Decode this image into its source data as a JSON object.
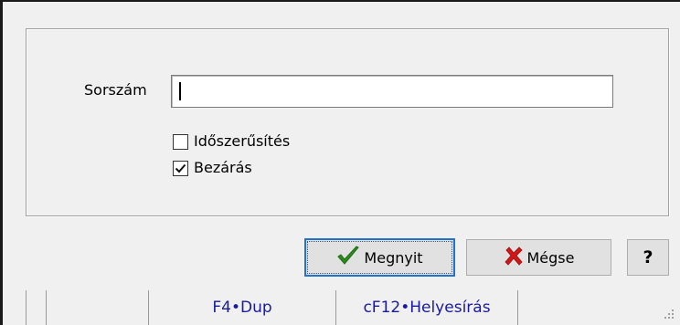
{
  "form": {
    "sorszam_label": "Sorszám",
    "sorszam_value": "",
    "idoszerusites_label": "Időszerűsítés",
    "idoszerusites_checked": false,
    "bezaras_label": "Bezárás",
    "bezaras_checked": true
  },
  "buttons": {
    "open_label": "Megnyit",
    "cancel_label": "Mégse",
    "help_label": "?"
  },
  "statusbar": {
    "cells": [
      "",
      "",
      "F4•Dup",
      "cF12•Helyesírás"
    ]
  },
  "colors": {
    "window_bg": "#f0f0f0",
    "status_text": "#1a1a9c",
    "check_icon": "#2e8b1f",
    "cancel_icon": "#d01818",
    "default_border": "#1c73d2"
  },
  "icons": {
    "open": "green-checkmark-icon",
    "cancel": "red-x-icon"
  }
}
